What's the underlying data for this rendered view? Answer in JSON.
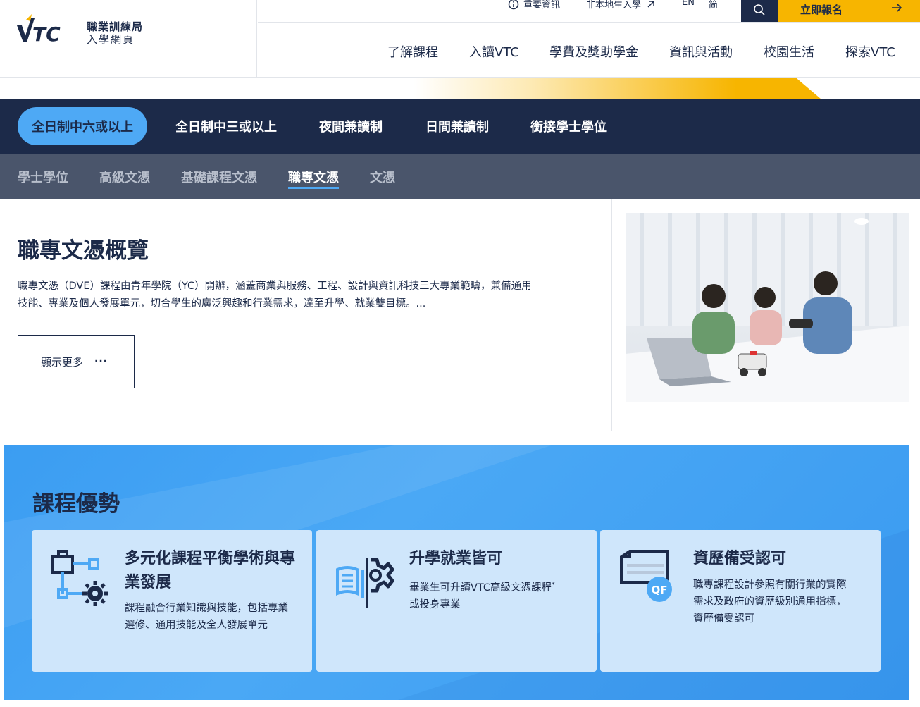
{
  "brand": {
    "logo_text": "VTC",
    "name_line1": "職業訓練局",
    "name_line2": "入學網頁"
  },
  "utility": {
    "important_info": "重要資訊",
    "non_local": "非本地生入學",
    "lang_en": "EN",
    "lang_sc": "简",
    "apply_label": "立即報名"
  },
  "main_nav": {
    "items": [
      "了解課程",
      "入讀VTC",
      "學費及獎助學金",
      "資訊與活動",
      "校園生活",
      "探索VTC"
    ]
  },
  "primary_tabs": {
    "items": [
      "全日制中六或以上",
      "全日制中三或以上",
      "夜間兼讀制",
      "日間兼讀制",
      "銜接學士學位"
    ],
    "active_index": 0
  },
  "secondary_tabs": {
    "items": [
      "學士學位",
      "高級文憑",
      "基礎課程文憑",
      "職專文憑",
      "文憑"
    ],
    "active_index": 3
  },
  "overview": {
    "title": "職專文憑概覽",
    "desc_line1": "職專文憑（DVE）課程由青年學院（YC）開辦，涵蓋商業與服務、工程、設計與資訊科技三大專業範疇，兼備通用",
    "desc_line2": "技能、專業及個人發展單元，切合學生的廣泛興趣和行業需求，達至升學、就業雙目標。...",
    "more_label": "顯示更多",
    "more_dots": "···"
  },
  "advantages": {
    "title": "課程優勢",
    "cards": [
      {
        "icon": "balance-icon",
        "title": "多元化課程平衡學術與專業發展",
        "text": "課程融合行業知識與技能，包括專業選修、通用技能及全人發展單元"
      },
      {
        "icon": "book-gear-icon",
        "title": "升學就業皆可",
        "text": "畢業生可升讀VTC高級文憑課程",
        "text_sup": "*",
        "text2": "或投身專業"
      },
      {
        "icon": "certificate-qf-icon",
        "title": "資歷備受認可",
        "text": "職專課程設計參照有關行業的實際需求及政府的資歷級別通用指標，資歷備受認可",
        "badge": "QF"
      }
    ]
  },
  "colors": {
    "navy": "#1c2a49",
    "accent_blue": "#4ea9f5",
    "accent_yellow": "#f7b500"
  }
}
